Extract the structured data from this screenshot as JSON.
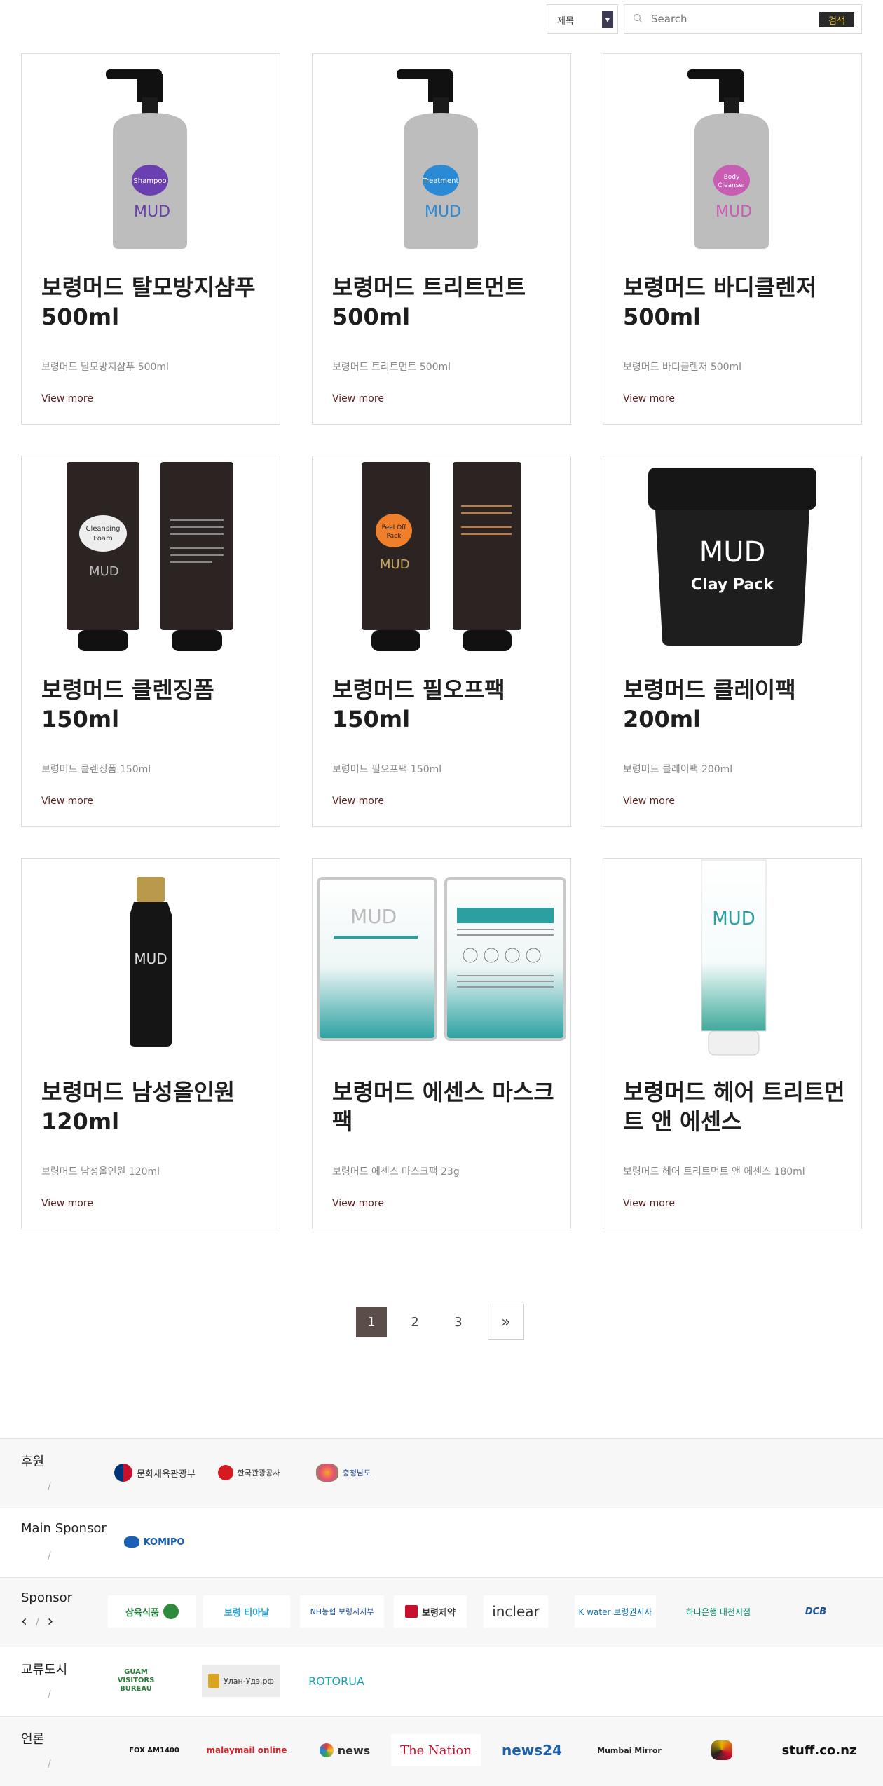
{
  "search": {
    "select_value": "제목",
    "placeholder": "Search",
    "button_label": "검색"
  },
  "products": [
    {
      "title": "보령머드 탈모방지샴푸 500ml",
      "desc": "보령머드 탈모방지샴푸 500ml",
      "more": "View more",
      "label": "Shampoo"
    },
    {
      "title": "보령머드 트리트먼트 500ml",
      "desc": "보령머드 트리트먼트 500ml",
      "more": "View more",
      "label": "Treatment"
    },
    {
      "title": "보령머드 바디클렌저 500ml",
      "desc": "보령머드 바디클렌저 500ml",
      "more": "View more",
      "label": "Body Cleanser"
    },
    {
      "title": "보령머드 클렌징폼 150ml",
      "desc": "보령머드 클렌징폼 150ml",
      "more": "View more",
      "label": "Cleansing Foam"
    },
    {
      "title": "보령머드 필오프팩 150ml",
      "desc": "보령머드 필오프팩 150ml",
      "more": "View more",
      "label": "Peel Off Pack"
    },
    {
      "title": "보령머드 클레이팩 200ml",
      "desc": "보령머드 클레이팩 200ml",
      "more": "View more",
      "label": "Clay Pack"
    },
    {
      "title": "보령머드 남성올인원 120ml",
      "desc": "보령머드 남성올인원 120ml",
      "more": "View more",
      "label": "MUD"
    },
    {
      "title": "보령머드 에센스 마스크팩",
      "desc": "보령머드 에센스 마스크팩 23g",
      "more": "View more",
      "label": "MUD"
    },
    {
      "title": "보령머드 헤어 트리트먼트 앤 에센스",
      "desc": "보령머드 헤어 트리트먼트 앤 에센스 180ml",
      "more": "View more",
      "label": "MUD"
    }
  ],
  "pagination": {
    "pages": [
      "1",
      "2",
      "3"
    ],
    "current": "1",
    "next": "»"
  },
  "sponsors": {
    "rows": [
      {
        "label": "후원",
        "logos": [
          "문화체육관광부",
          "한국관광공사",
          "충청남도"
        ]
      },
      {
        "label": "Main Sponsor",
        "logos": [
          "KOMIPO"
        ]
      },
      {
        "label": "Sponsor",
        "logos": [
          "삼육식품",
          "보령 티아날",
          "NH농협 보령시지부",
          "보령제약",
          "inclear",
          "K water 보령권지사",
          "하나은행 대천지점",
          "DCB"
        ]
      },
      {
        "label": "교류도시",
        "logos": [
          "GUAM VISITORS BUREAU",
          "Улан-Удэ.рф",
          "ROTORUA"
        ]
      },
      {
        "label": "언론",
        "logos": [
          "FOX AM1400",
          "malaymail online",
          "news",
          "The Nation",
          "news24",
          "Mumbai Mirror",
          "",
          "stuff.co.nz"
        ]
      }
    ],
    "slash": "/",
    "prev": "‹",
    "next": "›"
  },
  "colors": {
    "accent": "#5b4e4a",
    "link": "#5a1f1f",
    "search_button": "#2a2a2a",
    "search_button_text": "#e6c23a"
  }
}
